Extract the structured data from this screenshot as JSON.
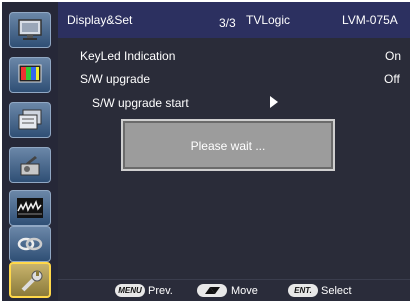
{
  "sidebar": {
    "items": [
      {
        "icon": "monitor-icon"
      },
      {
        "icon": "color-picture-icon"
      },
      {
        "icon": "window-layout-icon"
      },
      {
        "icon": "audio-speaker-icon"
      },
      {
        "icon": "waveform-icon"
      },
      {
        "icon": "link-icon"
      },
      {
        "icon": "wrench-icon",
        "active": true
      }
    ]
  },
  "header": {
    "section": "Display&Set",
    "page": "3/3",
    "brand": "TVLogic",
    "model": "LVM-075A"
  },
  "menu": {
    "items": [
      {
        "label": "KeyLed Indication",
        "value": "On"
      },
      {
        "label": "S/W upgrade",
        "value": "Off"
      }
    ],
    "submenu": {
      "label": "S/W upgrade start"
    }
  },
  "dialog": {
    "message": "Please wait ..."
  },
  "footer": {
    "menu_key": "MENU",
    "prev": "Prev.",
    "move": "Move",
    "ent_key": "ENT.",
    "select": "Select"
  }
}
